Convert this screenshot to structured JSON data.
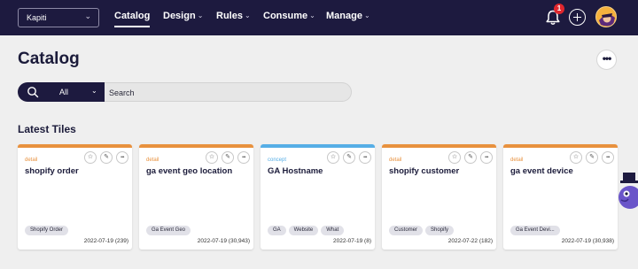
{
  "workspace": {
    "value": "Kapiti"
  },
  "nav": [
    {
      "label": "Catalog",
      "active": true,
      "dropdown": false
    },
    {
      "label": "Design",
      "active": false,
      "dropdown": true
    },
    {
      "label": "Rules",
      "active": false,
      "dropdown": true
    },
    {
      "label": "Consume",
      "active": false,
      "dropdown": true
    },
    {
      "label": "Manage",
      "active": false,
      "dropdown": true
    }
  ],
  "notifications": {
    "count": "1",
    "icon": "bell-icon"
  },
  "header": {
    "title": "Catalog",
    "more_icon": "ellipsis-icon"
  },
  "search": {
    "scope": "All",
    "placeholder": "Search",
    "icon": "search-icon"
  },
  "section": {
    "title": "Latest Tiles"
  },
  "tiles": [
    {
      "type": "detail",
      "name": "shopify order",
      "tags": [
        "Shopify Order"
      ],
      "footer": "2022-07-19 (239)",
      "color": "#e8913e"
    },
    {
      "type": "detail",
      "name": "ga event geo location",
      "tags": [
        "Ga Event Geo"
      ],
      "footer": "2022-07-19 (30,943)",
      "color": "#e8913e"
    },
    {
      "type": "concept",
      "name": "GA Hostname",
      "tags": [
        "GA",
        "Website",
        "What"
      ],
      "footer": "2022-07-19 (8)",
      "color": "#56aee6"
    },
    {
      "type": "detail",
      "name": "shopify customer",
      "tags": [
        "Customer",
        "Shopify"
      ],
      "footer": "2022-07-22 (182)",
      "color": "#e8913e"
    },
    {
      "type": "detail",
      "name": "ga event device",
      "tags": [
        "Ga Event Devi..."
      ],
      "footer": "2022-07-19 (30,938)",
      "color": "#e8913e"
    }
  ],
  "colors": {
    "navbar": "#1d1a3f",
    "detail_accent": "#e8913e",
    "concept_accent": "#56aee6",
    "badge": "#e0262d"
  }
}
